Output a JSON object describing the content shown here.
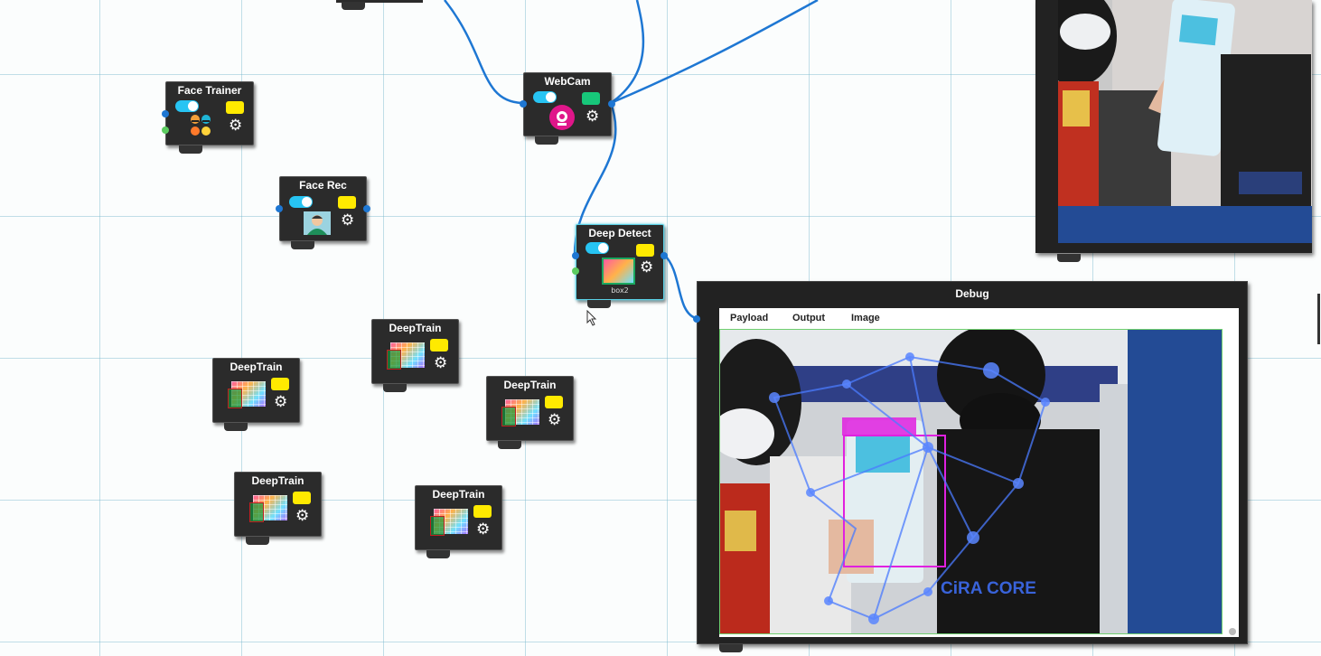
{
  "nodes": {
    "face_trainer": {
      "title": "Face Trainer"
    },
    "face_rec": {
      "title": "Face Rec"
    },
    "webcam": {
      "title": "WebCam"
    },
    "deep_detect": {
      "title": "Deep Detect",
      "sublabel": "box2"
    },
    "deeptrain_1": {
      "title": "DeepTrain"
    },
    "deeptrain_2": {
      "title": "DeepTrain"
    },
    "deeptrain_3": {
      "title": "DeepTrain"
    },
    "deeptrain_4": {
      "title": "DeepTrain"
    },
    "deeptrain_5": {
      "title": "DeepTrain"
    }
  },
  "debug": {
    "title": "Debug",
    "tabs": [
      "Payload",
      "Output",
      "Image"
    ],
    "overlay_text": "CiRA CORE"
  },
  "colors": {
    "accent": "#27c4f3",
    "wire": "#1e77d3",
    "note": "#ffea00",
    "node_bg": "#2b2b2b",
    "selected_outline": "#5ad1e6",
    "detection_box": "#e020e0",
    "side_bar": "#234b95"
  },
  "icons": [
    "toggle-icon",
    "note-icon",
    "gear-icon",
    "webcam-icon",
    "face-icon",
    "face-user-icon",
    "train-image-icon",
    "detect-image-icon",
    "cursor-icon"
  ]
}
